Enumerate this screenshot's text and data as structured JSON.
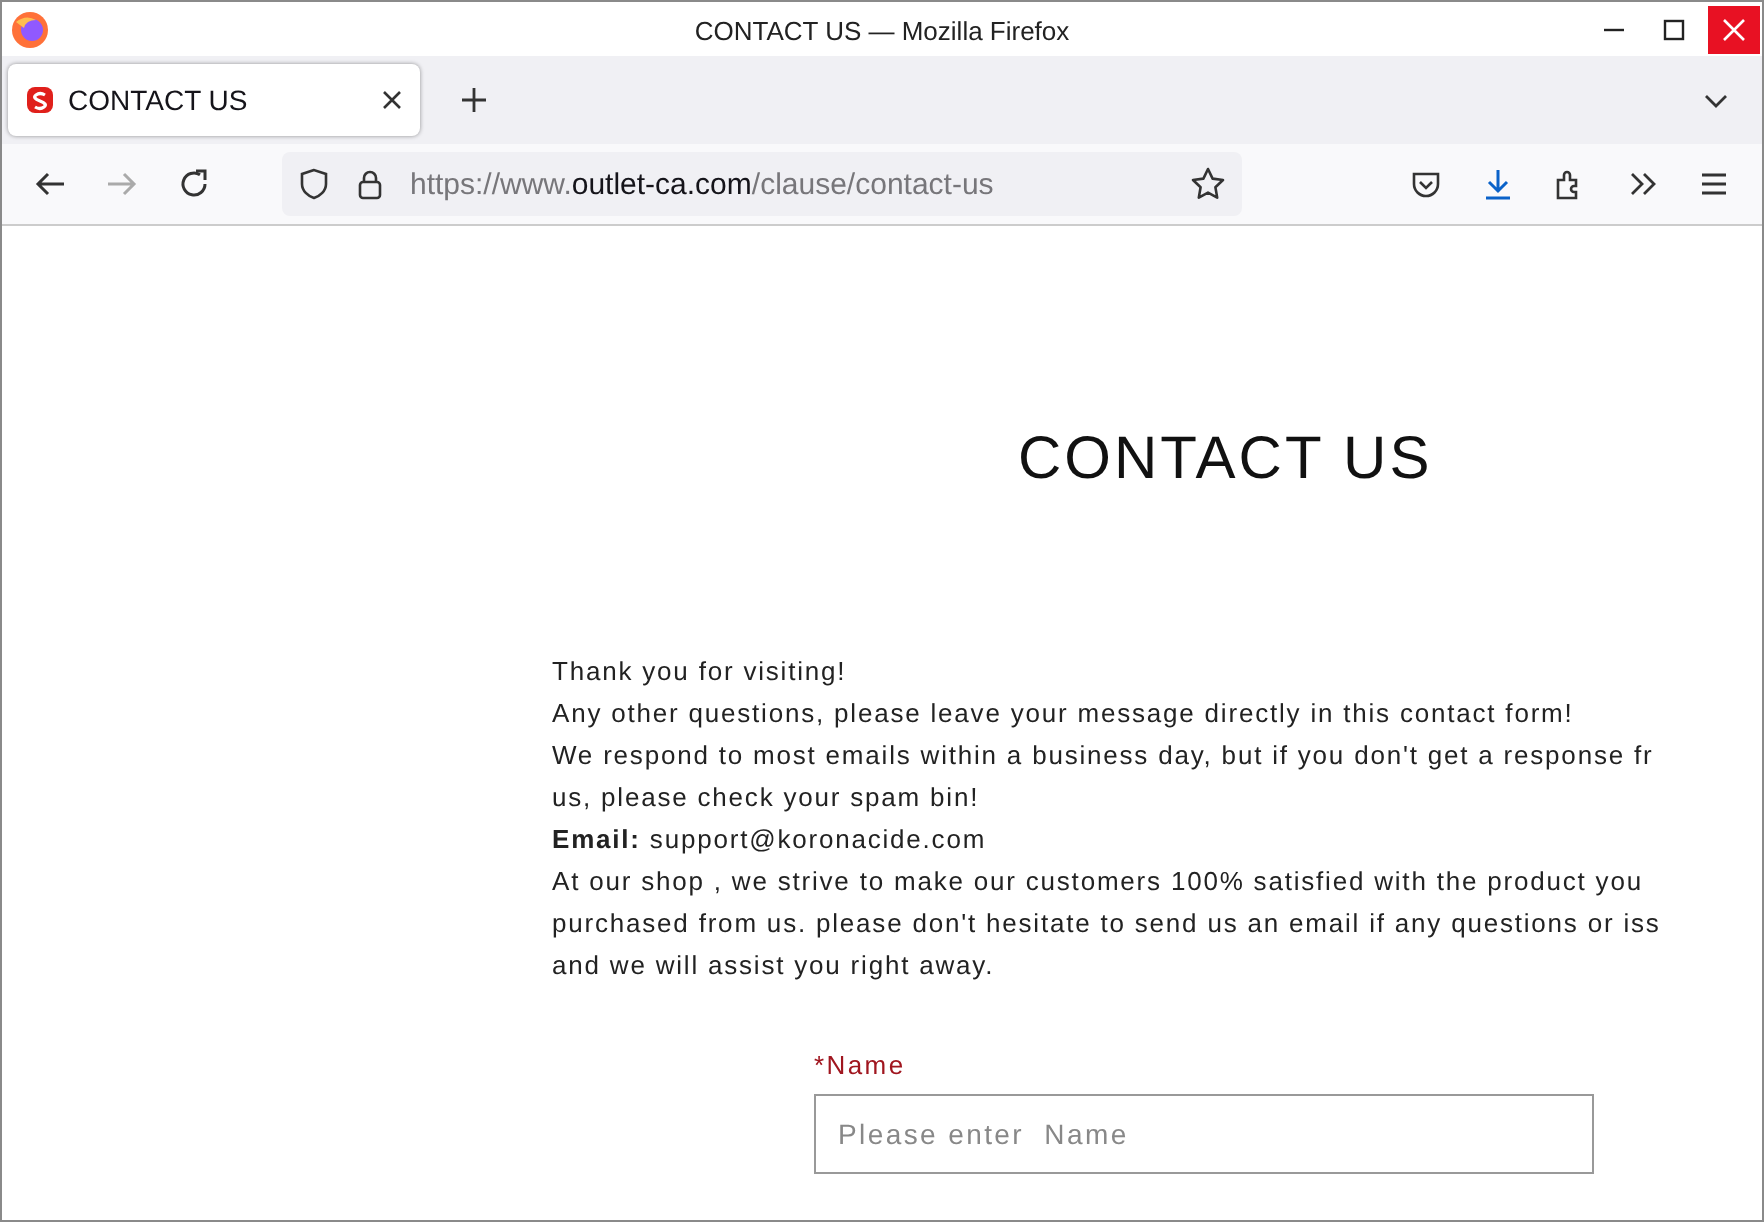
{
  "window": {
    "title": "CONTACT US — Mozilla Firefox"
  },
  "tabs": [
    {
      "label": "CONTACT US",
      "selected": true
    }
  ],
  "address_bar": {
    "scheme": "https://www.",
    "domain": "outlet-ca.com",
    "path": "/clause/contact-us"
  },
  "page": {
    "heading": "CONTACT US",
    "lines": [
      "Thank you for visiting!",
      "Any other questions, please leave your message directly in this contact form!",
      "We respond to most emails within a business day, but if you don't get a response fr",
      "us, please check your spam bin!",
      "**Email:** support@koronacide.com",
      "At our shop , we strive to make our customers 100% satisfied with the product you",
      "purchased from us. please don't hesitate to send us an email if any questions or iss",
      "and we will assist you right away."
    ],
    "form": {
      "fields": [
        {
          "required_mark": "*",
          "label": "Name",
          "placeholder": "Please enter  Name"
        }
      ]
    }
  }
}
